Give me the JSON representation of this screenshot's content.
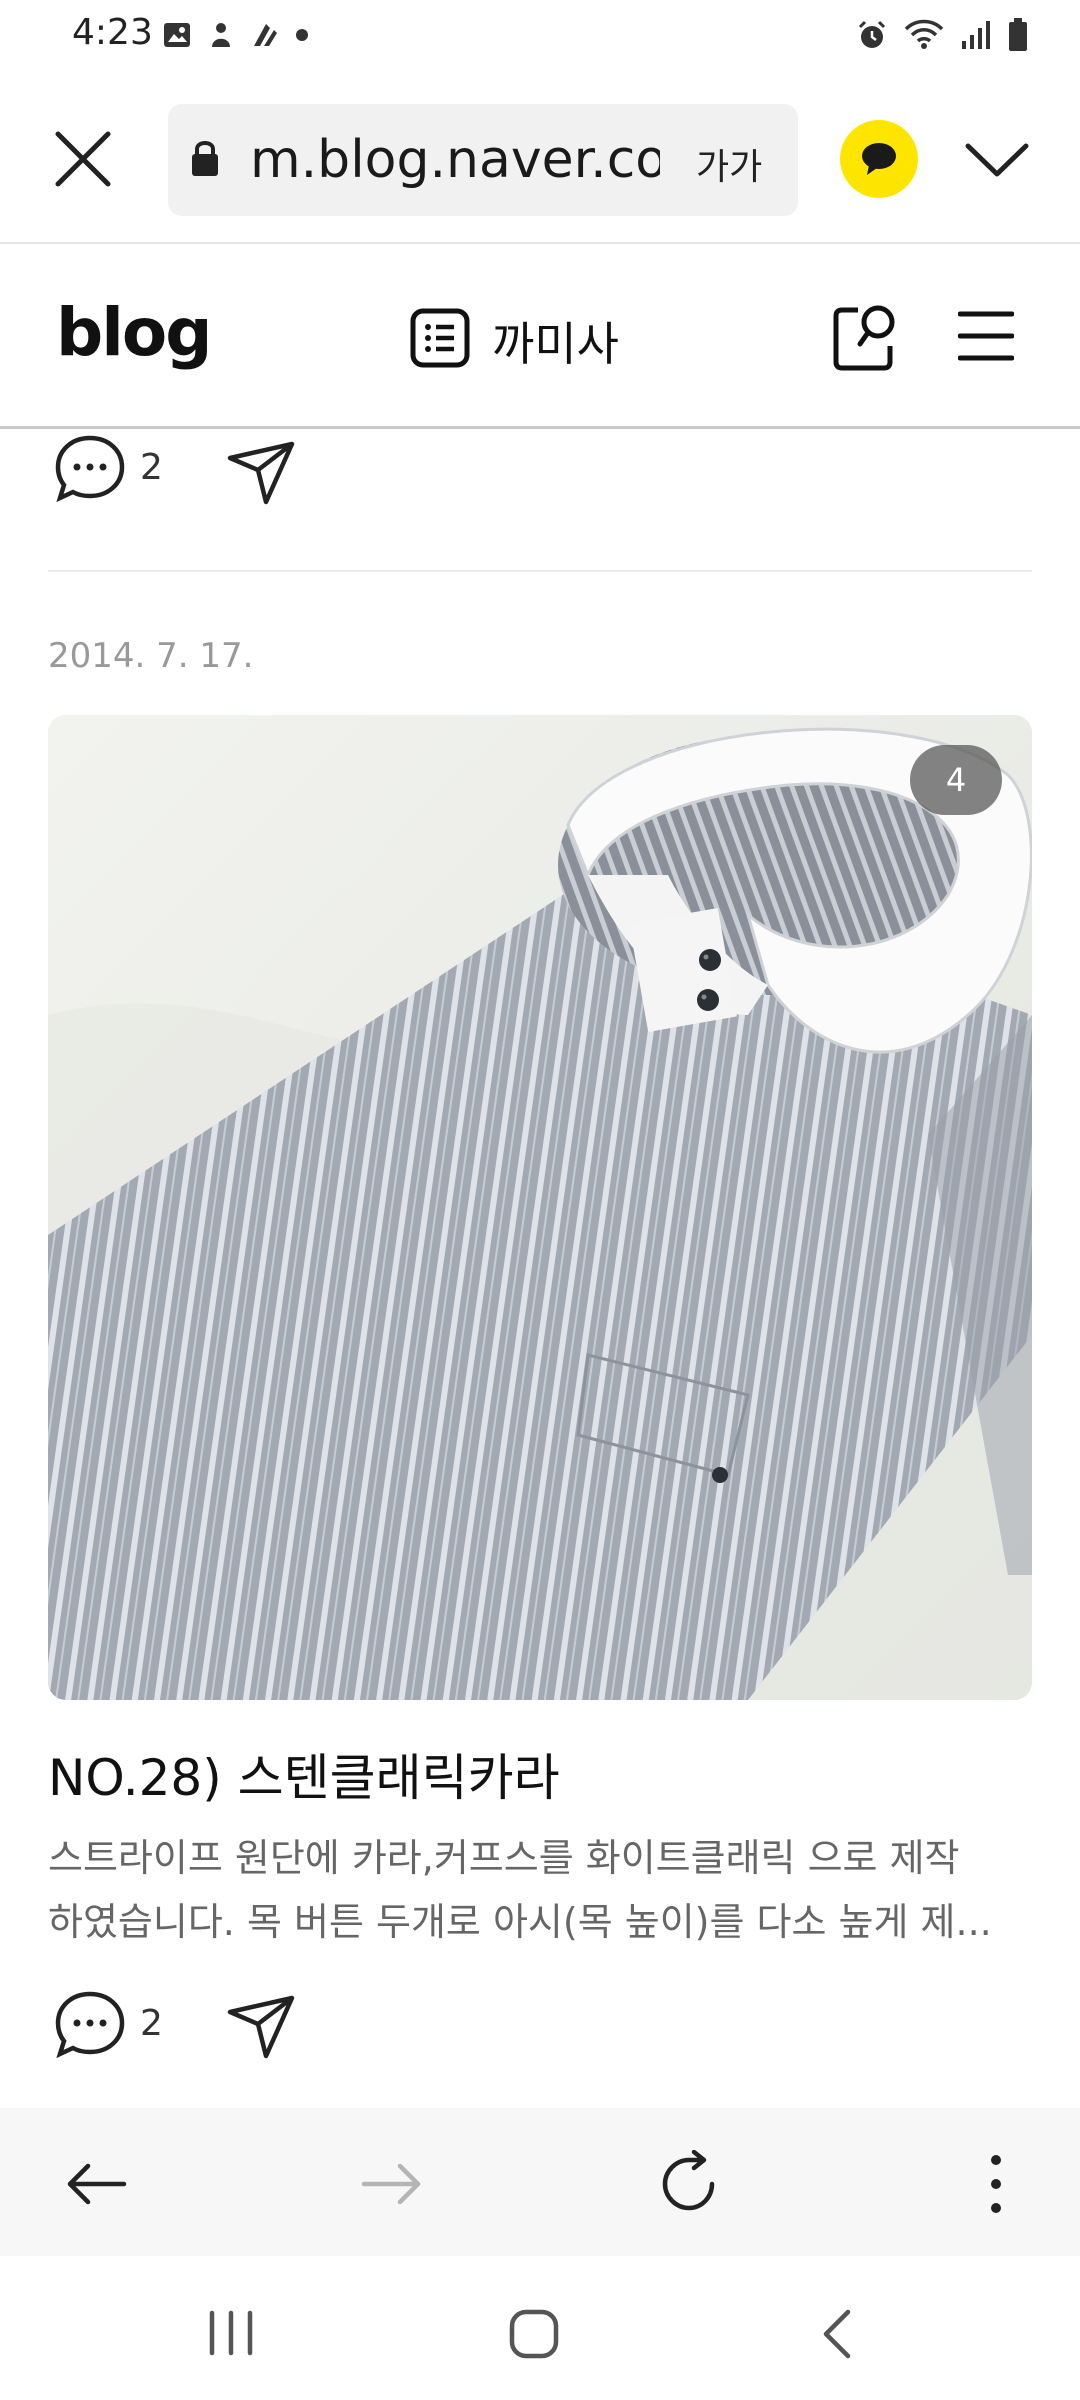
{
  "status_bar": {
    "time": "4:23",
    "left_icons": [
      "gallery-icon",
      "notification-icon",
      "notification-icon-2",
      "dot-icon"
    ],
    "right_icons": [
      "alarm-icon",
      "wifi-icon",
      "signal-icon",
      "battery-icon"
    ]
  },
  "browser": {
    "url": "m.blog.naver.co",
    "text_size_label": "가가",
    "kakao_color": "#fee500"
  },
  "blog_header": {
    "logo": "blog",
    "blog_name": "까미사"
  },
  "prev_post_actions": {
    "comment_count": "2"
  },
  "post": {
    "date": "2014. 7. 17.",
    "image_count": "4",
    "title": "NO.28) 스텐클래릭카라",
    "excerpt_line1": "스트라이프 원단에 카라,커프스를 화이트클래릭 으로 제작",
    "excerpt_line2": "하였습니다. 목 버튼 두개로 아시(목 높이)를 다소 높게 제...",
    "comment_count": "2"
  }
}
